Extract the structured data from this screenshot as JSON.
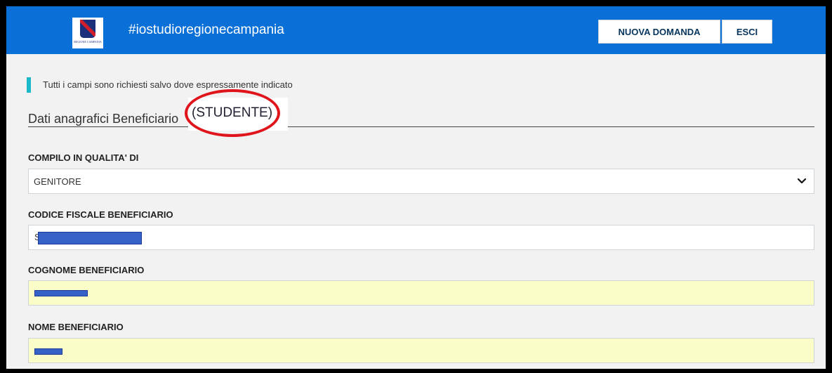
{
  "header": {
    "logo_text": "REGIONE CAMPANIA",
    "site_title": "#iostudioregionecampania",
    "new_request_label": "NUOVA DOMANDA",
    "exit_label": "ESCI"
  },
  "notice": "Tutti i campi sono richiesti salvo dove espressamente indicato",
  "section_title": "Dati anagrafici Beneficiario",
  "annotation": "(STUDENTE)",
  "form": {
    "role": {
      "label": "COMPILO IN QUALITA' DI",
      "value": "GENITORE"
    },
    "tax_code": {
      "label": "CODICE FISCALE BENEFICIARIO",
      "visible_value": "S"
    },
    "surname": {
      "label": "COGNOME BENEFICIARIO"
    },
    "name": {
      "label": "NOME BENEFICIARIO"
    }
  },
  "colors": {
    "header_bg": "#0a6fd6",
    "accent_bar": "#1ab8c8",
    "autofill_bg": "#fafdc8",
    "redaction": "#3661c7",
    "annotation_circle": "#e0141b"
  }
}
